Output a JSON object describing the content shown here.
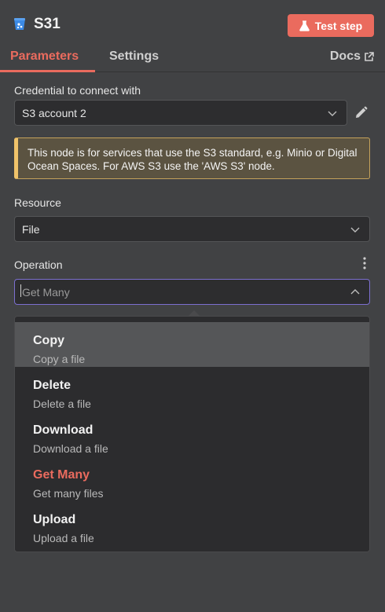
{
  "header": {
    "title": "S31",
    "test_step_label": "Test step"
  },
  "tabs": [
    {
      "label": "Parameters"
    },
    {
      "label": "Settings"
    }
  ],
  "docs_label": "Docs",
  "credential": {
    "label": "Credential to connect with",
    "value": "S3 account 2"
  },
  "notice": "This node is for services that use the S3 standard, e.g. Minio or Digital Ocean Spaces. For AWS S3 use the 'AWS S3' node.",
  "resource": {
    "label": "Resource",
    "value": "File"
  },
  "operation": {
    "label": "Operation",
    "placeholder": "Get Many"
  },
  "operation_options": [
    {
      "title": "Copy",
      "desc": "Copy a file"
    },
    {
      "title": "Delete",
      "desc": "Delete a file"
    },
    {
      "title": "Download",
      "desc": "Download a file"
    },
    {
      "title": "Get Many",
      "desc": "Get many files"
    },
    {
      "title": "Upload",
      "desc": "Upload a file"
    }
  ],
  "colors": {
    "accent": "#ea6b5e",
    "focus": "#7c6fcf",
    "notice_border": "#f0c36a"
  }
}
